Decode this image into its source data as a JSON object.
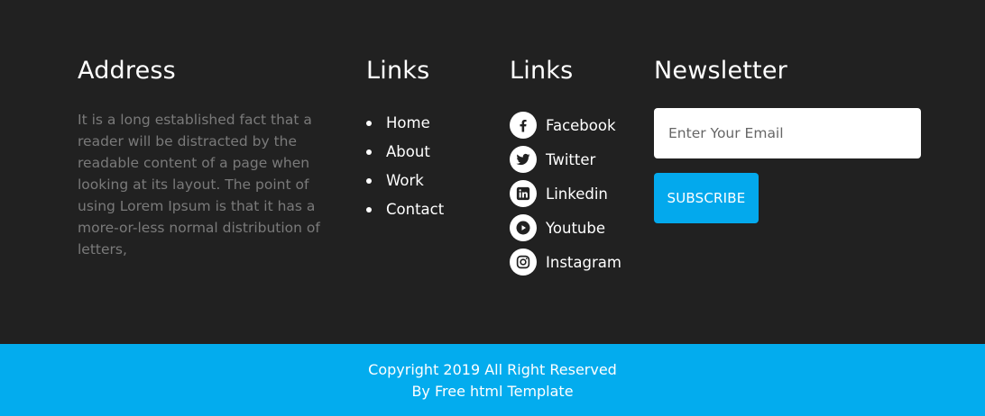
{
  "colors": {
    "background": "#212121",
    "accent": "#03a9ed",
    "muted_text": "#7a7a7a",
    "text": "#ffffff"
  },
  "address": {
    "heading": "Address",
    "text": "It is a long established fact that a reader will be distracted by the readable content of a page when looking at its layout. The point of using Lorem Ipsum is that it has a more-or-less normal distribution of letters,"
  },
  "links": {
    "heading": "Links",
    "items": [
      {
        "label": "Home"
      },
      {
        "label": "About"
      },
      {
        "label": "Work"
      },
      {
        "label": "Contact"
      }
    ]
  },
  "social": {
    "heading": "Links",
    "items": [
      {
        "label": "Facebook",
        "icon": "facebook-icon"
      },
      {
        "label": "Twitter",
        "icon": "twitter-icon"
      },
      {
        "label": "Linkedin",
        "icon": "linkedin-icon"
      },
      {
        "label": "Youtube",
        "icon": "youtube-icon"
      },
      {
        "label": "Instagram",
        "icon": "instagram-icon"
      }
    ]
  },
  "newsletter": {
    "heading": "Newsletter",
    "email_placeholder": "Enter Your Email",
    "email_value": "",
    "subscribe_label": "SUBSCRIBE"
  },
  "copyright": {
    "line1": "Copyright 2019 All Right Reserved",
    "line2": "By Free html Template"
  }
}
